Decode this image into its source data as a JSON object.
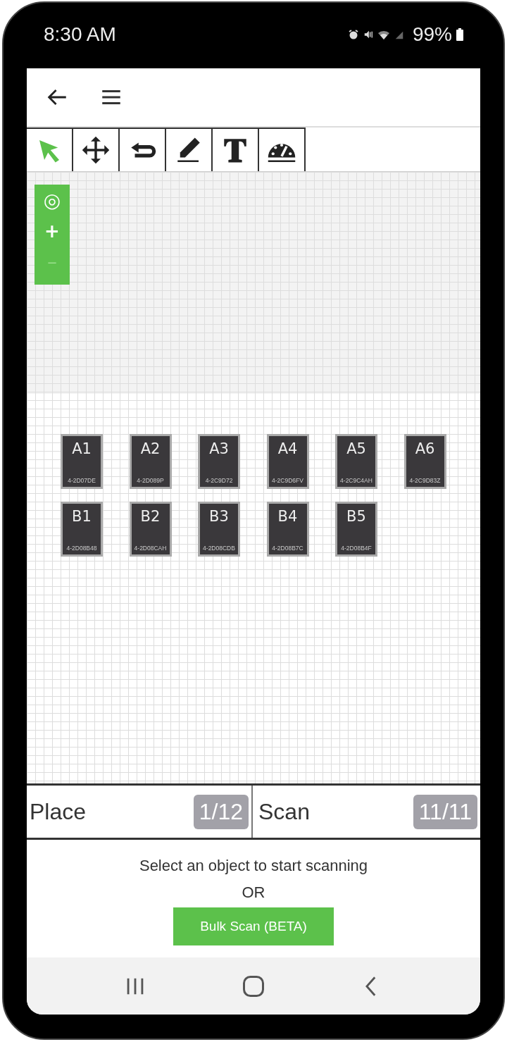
{
  "status_bar": {
    "time": "8:30 AM",
    "battery": "99%"
  },
  "toolbar": {
    "tools": [
      {
        "kind": "select",
        "selected": true
      },
      {
        "kind": "move",
        "selected": false
      },
      {
        "kind": "undo",
        "selected": false
      },
      {
        "kind": "draw",
        "selected": false
      },
      {
        "kind": "text",
        "selected": false
      },
      {
        "kind": "gauge",
        "selected": false
      }
    ]
  },
  "zoom_controls": [
    "◎",
    "+",
    "−"
  ],
  "tiles": [
    {
      "label": "A1",
      "code": "4-2D07DE"
    },
    {
      "label": "A2",
      "code": "4-2D089P"
    },
    {
      "label": "A3",
      "code": "4-2C9D72"
    },
    {
      "label": "A4",
      "code": "4-2C9D6FV"
    },
    {
      "label": "A5",
      "code": "4-2C9C4AH"
    },
    {
      "label": "A6",
      "code": "4-2C9D83Z"
    },
    {
      "label": "B1",
      "code": "4-2D08B48"
    },
    {
      "label": "B2",
      "code": "4-2D08CAH"
    },
    {
      "label": "B3",
      "code": "4-2D08CDB"
    },
    {
      "label": "B4",
      "code": "4-2D08B7C"
    },
    {
      "label": "B5",
      "code": "4-2D08B4F"
    }
  ],
  "counters": [
    {
      "label": "Place",
      "count": "1/12"
    },
    {
      "label": "Scan",
      "count": "11/11"
    }
  ],
  "scan_panel": {
    "message": "Select an object to start scanning",
    "separator": "OR",
    "button": "Bulk Scan (BETA)"
  }
}
